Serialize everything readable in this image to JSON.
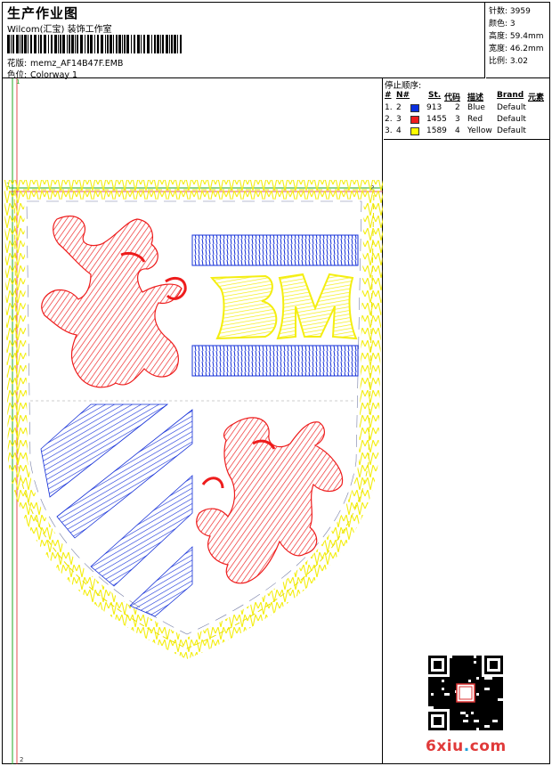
{
  "header": {
    "title": "生产作业图",
    "subtitle": "Wilcom(汇宝) 装饰工作室",
    "design_label": "花版:",
    "design_value": "memz_AF14B47F.EMB",
    "colorway_label": "色位:",
    "colorway_value": "Colorway 1"
  },
  "stats": [
    {
      "label": "针数:",
      "value": "3959"
    },
    {
      "label": "颜色:",
      "value": "3"
    },
    {
      "label": "高度:",
      "value": "59.4mm"
    },
    {
      "label": "宽度:",
      "value": "46.2mm"
    },
    {
      "label": "比例:",
      "value": "3.02"
    }
  ],
  "stop_sequence": {
    "title": "停止顺序:",
    "headers": [
      "#",
      "N#",
      "St.",
      "代码",
      "描述",
      "Brand",
      "元素"
    ],
    "rows": [
      {
        "num": "1.",
        "n": "2",
        "color": "#0a2fe0",
        "st": "913",
        "code": "2",
        "desc": "Blue",
        "brand": "Default"
      },
      {
        "num": "2.",
        "n": "3",
        "color": "#f01c1c",
        "st": "1455",
        "code": "3",
        "desc": "Red",
        "brand": "Default"
      },
      {
        "num": "3.",
        "n": "4",
        "color": "#ffff00",
        "st": "1589",
        "code": "4",
        "desc": "Yellow",
        "brand": "Default"
      }
    ]
  },
  "canvas": {
    "marker_1_top": "1",
    "marker_1_left": "1",
    "marker_2_right": "2",
    "marker_2_bottom": "2",
    "monogram": "BM"
  },
  "colors": {
    "blue": "#1530d8",
    "red": "#ee1c1c",
    "yellow": "#f4ee10",
    "guide_green": "#22aa22",
    "guide_red": "#dd2222"
  },
  "watermark": {
    "site_prefix": "6xiu",
    "site_dot": ".",
    "site_suffix": "com"
  }
}
